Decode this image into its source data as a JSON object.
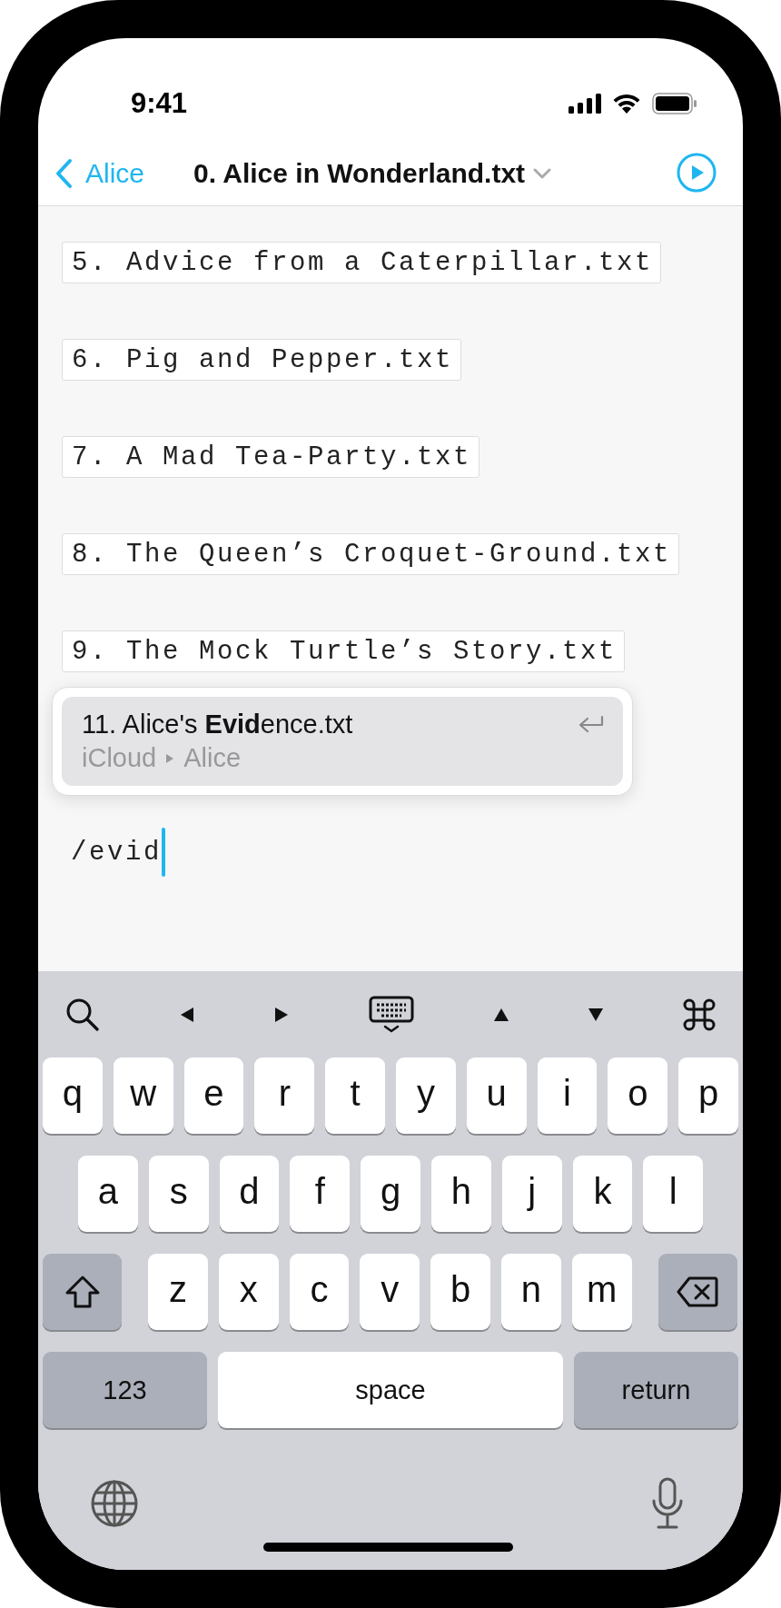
{
  "status_bar": {
    "time": "9:41"
  },
  "nav": {
    "back_label": "Alice",
    "title": "0. Alice in Wonderland.txt"
  },
  "links": [
    "5. Advice from a Caterpillar.txt",
    "6. Pig and Pepper.txt",
    "7. A Mad Tea-Party.txt",
    "8. The Queen’s Croquet-Ground.txt",
    "9. The Mock Turtle’s Story.txt"
  ],
  "suggestion": {
    "title": "11. Alice's **Evid**ence.txt",
    "path": [
      "iCloud",
      "Alice"
    ],
    "selected": true
  },
  "input": {
    "value": "/evid"
  },
  "keyboard": {
    "rows": [
      [
        {
          "kind": "letter",
          "label": "q"
        },
        {
          "kind": "letter",
          "label": "w"
        },
        {
          "kind": "letter",
          "label": "e"
        },
        {
          "kind": "letter",
          "label": "r"
        },
        {
          "kind": "letter",
          "label": "t"
        },
        {
          "kind": "letter",
          "label": "y"
        },
        {
          "kind": "letter",
          "label": "u"
        },
        {
          "kind": "letter",
          "label": "i"
        },
        {
          "kind": "letter",
          "label": "o"
        },
        {
          "kind": "letter",
          "label": "p"
        }
      ],
      [
        {
          "kind": "letter",
          "label": "a"
        },
        {
          "kind": "letter",
          "label": "s"
        },
        {
          "kind": "letter",
          "label": "d"
        },
        {
          "kind": "letter",
          "label": "f"
        },
        {
          "kind": "letter",
          "label": "g"
        },
        {
          "kind": "letter",
          "label": "h"
        },
        {
          "kind": "letter",
          "label": "j"
        },
        {
          "kind": "letter",
          "label": "k"
        },
        {
          "kind": "letter",
          "label": "l"
        }
      ],
      [
        {
          "kind": "shift"
        },
        {
          "kind": "letter",
          "label": "z"
        },
        {
          "kind": "letter",
          "label": "x"
        },
        {
          "kind": "letter",
          "label": "c"
        },
        {
          "kind": "letter",
          "label": "v"
        },
        {
          "kind": "letter",
          "label": "b"
        },
        {
          "kind": "letter",
          "label": "n"
        },
        {
          "kind": "letter",
          "label": "m"
        },
        {
          "kind": "delete"
        }
      ]
    ],
    "bottom_keys": [
      {
        "kind": "mode",
        "label": "123"
      },
      {
        "kind": "space",
        "label": "space"
      },
      {
        "kind": "return",
        "label": "return"
      }
    ]
  }
}
